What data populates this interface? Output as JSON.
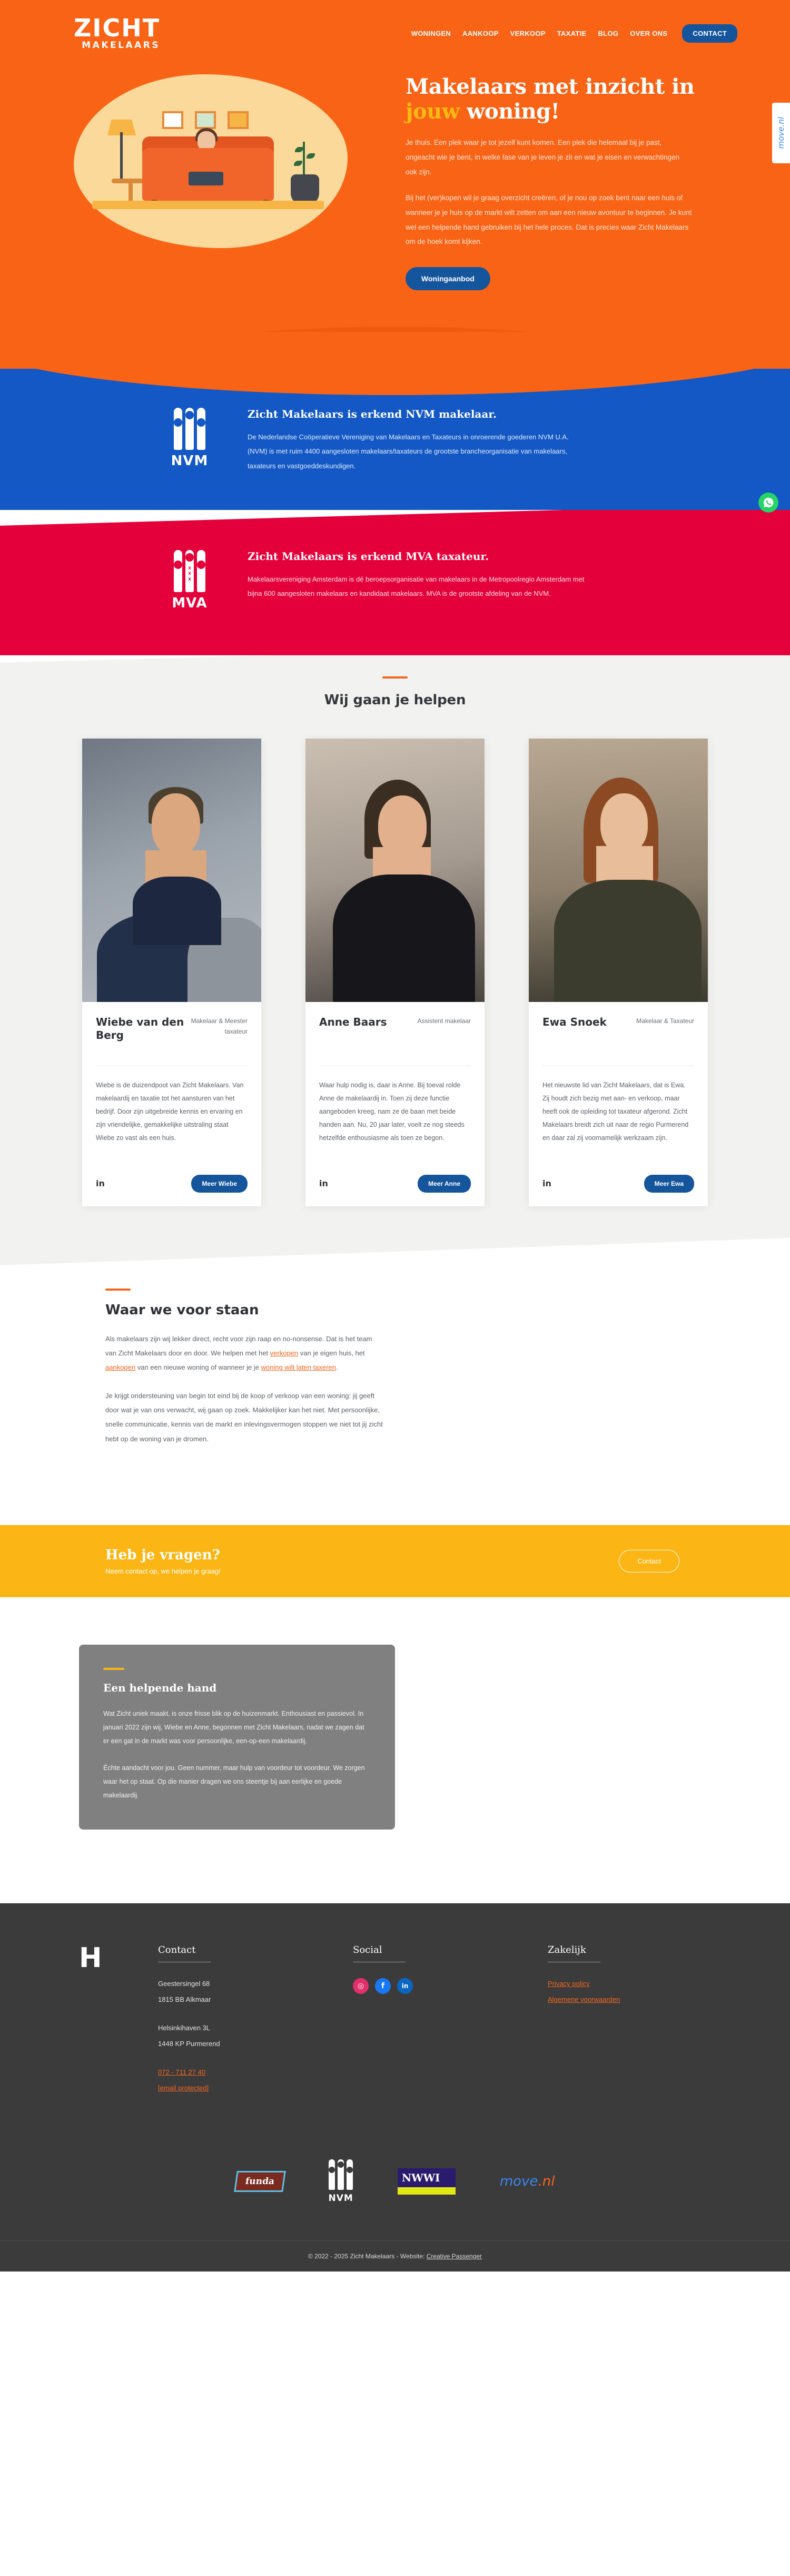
{
  "brand": {
    "logo_main": "ZICHT",
    "logo_sub": "MAKELAARS",
    "accent_orange": "#f96316",
    "accent_blue": "#15559c",
    "accent_yellow": "#fbb615",
    "accent_red": "#e4003a"
  },
  "nav": {
    "items": [
      {
        "label": "WONINGEN"
      },
      {
        "label": "AANKOOP"
      },
      {
        "label": "VERKOOP"
      },
      {
        "label": "TAXATIE"
      },
      {
        "label": "BLOG"
      },
      {
        "label": "OVER ONS"
      }
    ],
    "cta_label": "CONTACT"
  },
  "side_tab": {
    "label": "move.nl"
  },
  "hero": {
    "title_line1": "Makelaars met inzicht in",
    "title_accent": "jouw",
    "title_rest": " woning!",
    "paragraph1": "Je thuis. Een plek waar je tot jezelf kunt komen. Een plek die helemaal bij je past, ongeacht wie je bent, in welke fase van je leven je zit en wat je eisen en verwachtingen ook zijn.",
    "paragraph2": "Bij het (ver)kopen wil je graag overzicht creëren, of je nou op zoek bent naar een huis of wanneer je je huis op de markt wilt zetten om aan een nieuw avontuur te beginnen. Je kunt wel een helpende hand gebruiken bij het hele proces. Dat is precies waar Zicht Makelaars om de hoek komt kijken.",
    "button_label": "Woningaanbod"
  },
  "nvm_band": {
    "logo_label": "NVM",
    "title": "Zicht Makelaars is erkend NVM makelaar.",
    "paragraph": "De Nederlandse Coöperatieve Vereniging van Makelaars en Taxateurs in onroerende goederen NVM U.A. (NVM) is met ruim 4400 aangesloten makelaars/taxateurs de grootste brancheorganisatie van makelaars, taxateurs en vastgoeddeskundigen."
  },
  "mva_band": {
    "logo_label": "MVA",
    "title": "Zicht Makelaars is erkend MVA taxateur.",
    "paragraph": "Makelaarsvereniging Amsterdam is dé beroepsorganisatie van makelaars in de Metropoolregio Amsterdam met bijna 600 aangesloten makelaars en kandidaat makelaars. MVA is de grootste afdeling van de NVM."
  },
  "team": {
    "heading": "Wij gaan je helpen",
    "members": [
      {
        "name": "Wiebe van den Berg",
        "role": "Makelaar & Meester taxateur",
        "bio": "Wiebe is de duizendpoot van Zicht Makelaars. Van makelaardij en taxatie tot het aansturen van het bedrijf. Door zijn uitgebreide kennis en ervaring en zijn vriendelijke, gemakkelijke uitstraling staat Wiebe zo vast als een huis.",
        "linkedin_label": "in",
        "button_label": "Meer Wiebe"
      },
      {
        "name": "Anne Baars",
        "role": "Assistent makelaar",
        "bio": "Waar hulp nodig is, daar is Anne. Bij toeval rolde Anne de makelaardij in. Toen zij deze functie aangeboden kreeg, nam ze de baan met beide handen aan. Nu, 20 jaar later, voelt ze nog steeds hetzelfde enthousiasme als toen ze begon.",
        "linkedin_label": "in",
        "button_label": "Meer Anne"
      },
      {
        "name": "Ewa Snoek",
        "role": "Makelaar & Taxateur",
        "bio": "Het nieuwste lid van Zicht Makelaars, dat is Ewa. Zij houdt zich bezig met aan- en verkoop, maar heeft ook de opleiding tot taxateur afgerond. Zicht Makelaars breidt zich uit naar de regio Purmerend en daar zal zij voornamelijk werkzaam zijn.",
        "linkedin_label": "in",
        "button_label": "Meer Ewa"
      }
    ]
  },
  "values": {
    "heading": "Waar we voor staan",
    "p1_part1": "Als makelaars zijn wij lekker direct, recht voor zijn raap en no-nonsense. Dat is het team van Zicht Makelaars door en door. We helpen met het ",
    "p1_link1": "verkopen",
    "p1_part2": " van je eigen huis, het ",
    "p1_link2": "aankopen",
    "p1_part3": " van een nieuwe woning of wanneer je je ",
    "p1_link3": "woning wilt laten taxeren",
    "p1_part4": ".",
    "p2": "Je krijgt ondersteuning van begin tot eind bij de koop of verkoop van een woning: jij geeft door wat je van ons verwacht, wij gaan op zoek. Makkelijker kan het niet. Met persoonlijke, snelle communicatie, kennis van de markt en inlevingsvermogen stoppen we niet tot jij zicht hebt op de woning van je dromen."
  },
  "cta": {
    "title": "Heb je vragen?",
    "subtitle": "Neem contact op, we helpen je graag!",
    "button_label": "Contact"
  },
  "helping_hand": {
    "title": "Een helpende hand",
    "p1": "Wat Zicht uniek maakt, is onze frisse blik op de huizenmarkt. Enthousiast en passievol. In januari 2022 zijn wij, Wiebe en Anne, begonnen met Zicht Makelaars, nadat we zagen dat er een gat in de markt was voor persoonlijke, een-op-een makelaardij.",
    "p2": "Échte aandacht voor jou. Geen nummer, maar hulp van voordeur tot voordeur. We zorgen waar het op staat. Op die manier dragen we ons steentje bij aan eerlijke en goede makelaardij."
  },
  "footer": {
    "logo_mark": "H",
    "contact": {
      "heading": "Contact",
      "address1_line1": "Geestersingel 68",
      "address1_line2": "1815 BB Alkmaar",
      "address2_line1": "Helsinkihaven 3L",
      "address2_line2": "1448 KP Purmerend",
      "phone": "072 - 711 27 40",
      "email": "[email protected]"
    },
    "social": {
      "heading": "Social",
      "items": [
        {
          "name": "instagram-icon",
          "glyph": "◎",
          "color": "#e1306c"
        },
        {
          "name": "facebook-icon",
          "glyph": "f",
          "color": "#1877f2"
        },
        {
          "name": "linkedin-icon",
          "glyph": "in",
          "color": "#0a66c2"
        }
      ]
    },
    "business": {
      "heading": "Zakelijk",
      "links": [
        {
          "label": "Privacy policy"
        },
        {
          "label": "Algemene voorwaarden"
        }
      ]
    },
    "partners": [
      {
        "name": "funda-logo",
        "label": "funda"
      },
      {
        "name": "nvm-logo",
        "label": "NVM"
      },
      {
        "name": "nwwi-logo",
        "label": "NWWI"
      },
      {
        "name": "move-logo",
        "label_a": "move",
        "label_b": ".nl"
      }
    ],
    "copyright_prefix": "© 2022 - 2025 Zicht Makelaars - Website: ",
    "copyright_link": "Creative Passenger"
  },
  "whatsapp": {
    "label": "whatsapp-icon"
  }
}
